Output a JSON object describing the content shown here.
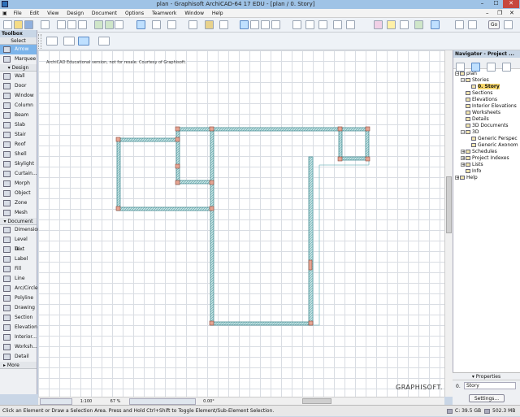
{
  "window": {
    "title": "plan - Graphisoft ArchiCAD-64 17 EDU - [plan / 0. Story]",
    "minimize": "–",
    "maximize": "☐",
    "close": "✕"
  },
  "menu": [
    "File",
    "Edit",
    "View",
    "Design",
    "Document",
    "Options",
    "Teamwork",
    "Window",
    "Help"
  ],
  "toolbar": {
    "go_label": "Go"
  },
  "toolbox": {
    "title": "Toolbox",
    "select_header": "Select",
    "select_tools": [
      {
        "label": "Arrow",
        "icon": "arrow-icon"
      },
      {
        "label": "Marquee",
        "icon": "marquee-icon"
      }
    ],
    "design_header": "Design",
    "design_tools": [
      {
        "label": "Wall",
        "icon": "wall-icon"
      },
      {
        "label": "Door",
        "icon": "door-icon"
      },
      {
        "label": "Window",
        "icon": "window-icon"
      },
      {
        "label": "Column",
        "icon": "column-icon"
      },
      {
        "label": "Beam",
        "icon": "beam-icon"
      },
      {
        "label": "Slab",
        "icon": "slab-icon"
      },
      {
        "label": "Stair",
        "icon": "stair-icon"
      },
      {
        "label": "Roof",
        "icon": "roof-icon"
      },
      {
        "label": "Shell",
        "icon": "shell-icon"
      },
      {
        "label": "Skylight",
        "icon": "skylight-icon"
      },
      {
        "label": "Curtain...",
        "icon": "curtain-wall-icon"
      },
      {
        "label": "Morph",
        "icon": "morph-icon"
      },
      {
        "label": "Object",
        "icon": "object-icon"
      },
      {
        "label": "Zone",
        "icon": "zone-icon"
      },
      {
        "label": "Mesh",
        "icon": "mesh-icon"
      }
    ],
    "document_header": "Document",
    "document_tools": [
      {
        "label": "Dimension",
        "icon": "dimension-icon"
      },
      {
        "label": "Level Di...",
        "icon": "level-dimension-icon"
      },
      {
        "label": "Text",
        "icon": "text-icon"
      },
      {
        "label": "Label",
        "icon": "label-icon"
      },
      {
        "label": "Fill",
        "icon": "fill-icon"
      },
      {
        "label": "Line",
        "icon": "line-icon"
      },
      {
        "label": "Arc/Circle",
        "icon": "arc-icon"
      },
      {
        "label": "Polyline",
        "icon": "polyline-icon"
      },
      {
        "label": "Drawing",
        "icon": "drawing-icon"
      },
      {
        "label": "Section",
        "icon": "section-icon"
      },
      {
        "label": "Elevation",
        "icon": "elevation-icon"
      },
      {
        "label": "Interior...",
        "icon": "interior-elevation-icon"
      },
      {
        "label": "Worksh...",
        "icon": "worksheet-icon"
      },
      {
        "label": "Detail",
        "icon": "detail-icon"
      }
    ],
    "more": "More"
  },
  "canvas": {
    "notice": "ArchiCAD Educational version, not for resale. Courtesy of Graphisoft.",
    "watermark": "GRAPHISOFT."
  },
  "navigator": {
    "title": "Navigator - Project ...",
    "tree": [
      {
        "label": "plan",
        "depth": 0,
        "exp": "−"
      },
      {
        "label": "Stories",
        "depth": 1,
        "exp": "−"
      },
      {
        "label": "0. Story",
        "depth": 2,
        "exp": "",
        "selected": true
      },
      {
        "label": "Sections",
        "depth": 1,
        "exp": ""
      },
      {
        "label": "Elevations",
        "depth": 1,
        "exp": ""
      },
      {
        "label": "Interior Elevations",
        "depth": 1,
        "exp": ""
      },
      {
        "label": "Worksheets",
        "depth": 1,
        "exp": ""
      },
      {
        "label": "Details",
        "depth": 1,
        "exp": ""
      },
      {
        "label": "3D Documents",
        "depth": 1,
        "exp": ""
      },
      {
        "label": "3D",
        "depth": 1,
        "exp": "−"
      },
      {
        "label": "Generic Perspec",
        "depth": 2,
        "exp": ""
      },
      {
        "label": "Generic Axonom",
        "depth": 2,
        "exp": ""
      },
      {
        "label": "Schedules",
        "depth": 1,
        "exp": "+"
      },
      {
        "label": "Project Indexes",
        "depth": 1,
        "exp": "+"
      },
      {
        "label": "Lists",
        "depth": 1,
        "exp": "+"
      },
      {
        "label": "Info",
        "depth": 1,
        "exp": ""
      },
      {
        "label": "Help",
        "depth": 0,
        "exp": "+"
      }
    ],
    "properties_header": "Properties",
    "story_num": "0.",
    "story_value": "Story",
    "settings": "Settings..."
  },
  "viewbar": {
    "scale": "1:100",
    "zoom": "67 %",
    "angle": "0.00°"
  },
  "status": {
    "message": "Click an Element or Draw a Selection Area. Press and Hold Ctrl+Shift to Toggle Element/Sub-Element Selection.",
    "disk": "C: 39.5 GB",
    "memory": "502.3 MB"
  },
  "colors": {
    "wall": "#5aa0a8",
    "selection": "#7cb4ea",
    "accent": "#9fc3e6"
  }
}
